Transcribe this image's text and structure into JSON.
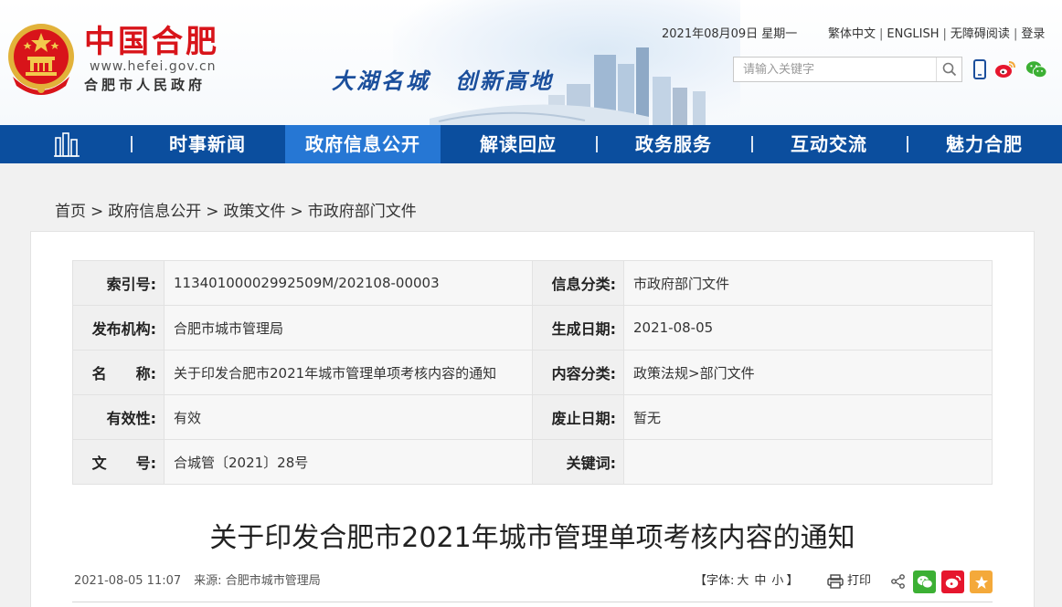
{
  "header": {
    "brand_title": "中国合肥",
    "brand_url": "www.hefei.gov.cn",
    "brand_sub": "合肥市人民政府",
    "slogan": "大湖名城　创新高地",
    "date": "2021年08月09日 星期一",
    "links": [
      "繁体中文",
      "ENGLISH",
      "无障碍阅读",
      "登录"
    ],
    "search_placeholder": "请输入关键字",
    "social_icons": [
      "mobile-icon",
      "weibo-icon",
      "wechat-icon"
    ],
    "colors": {
      "brand_red": "#d8141a",
      "slogan_blue": "#1b4f9c"
    }
  },
  "nav": {
    "items": [
      "时事新闻",
      "政府信息公开",
      "解读回应",
      "政务服务",
      "互动交流",
      "魅力合肥"
    ],
    "active_index": 1,
    "colors": {
      "bar": "#0b4e9e",
      "active": "#2677d4"
    }
  },
  "breadcrumb": [
    "首页",
    "政府信息公开",
    "政策文件",
    "市政府部门文件"
  ],
  "info": {
    "rows": [
      {
        "k1": "索引号:",
        "v1": "11340100002992509M/202108-00003",
        "k2": "信息分类:",
        "v2": "市政府部门文件"
      },
      {
        "k1": "发布机构:",
        "v1": "合肥市城市管理局",
        "k2": "生成日期:",
        "v2": "2021-08-05"
      },
      {
        "k1": "名　　称:",
        "v1": "关于印发合肥市2021年城市管理单项考核内容的通知",
        "k2": "内容分类:",
        "v2": "政策法规>部门文件"
      },
      {
        "k1": "有效性:",
        "v1": "有效",
        "k2": "废止日期:",
        "v2": "暂无"
      },
      {
        "k1": "文　　号:",
        "v1": "合城管〔2021〕28号",
        "k2": "关键词:",
        "v2": ""
      }
    ]
  },
  "article": {
    "title": "关于印发合肥市2021年城市管理单项考核内容的通知",
    "datetime": "2021-08-05 11:07",
    "source_label": "来源:",
    "source": "合肥市城市管理局",
    "font_label": "【字体:",
    "font_sizes": [
      "大",
      "中",
      "小"
    ],
    "font_close": "】",
    "print_label": "打印",
    "share_icons": [
      "wechat-share-icon",
      "weibo-share-icon",
      "favorite-icon"
    ],
    "colors": {
      "wechat": "#3cb034",
      "weibo": "#e6162d",
      "favorite": "#f4a93a"
    }
  }
}
